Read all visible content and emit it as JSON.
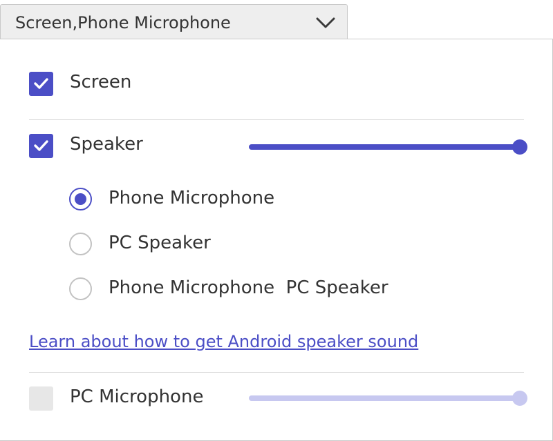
{
  "dropdown": {
    "value": "Screen,Phone Microphone",
    "icon": "chevron-down-icon"
  },
  "options": {
    "screen": {
      "label": "Screen",
      "checked": true
    },
    "speaker": {
      "label": "Speaker",
      "checked": true,
      "volume_percent": 100
    },
    "pc_microphone": {
      "label": "PC Microphone",
      "checked": false,
      "enabled": false,
      "volume_percent": 100
    }
  },
  "speaker_sources": [
    {
      "label": "Phone Microphone",
      "selected": true
    },
    {
      "label": "PC Speaker",
      "selected": false
    },
    {
      "label": "Phone Microphone  PC Speaker",
      "selected": false
    }
  ],
  "help_link": {
    "label": "Learn about how to get Android speaker sound"
  },
  "colors": {
    "accent": "#4b4ec6",
    "accent_disabled": "#c7c8f0",
    "disabled_box": "#e7e7e7",
    "divider": "#d8d8d8"
  }
}
